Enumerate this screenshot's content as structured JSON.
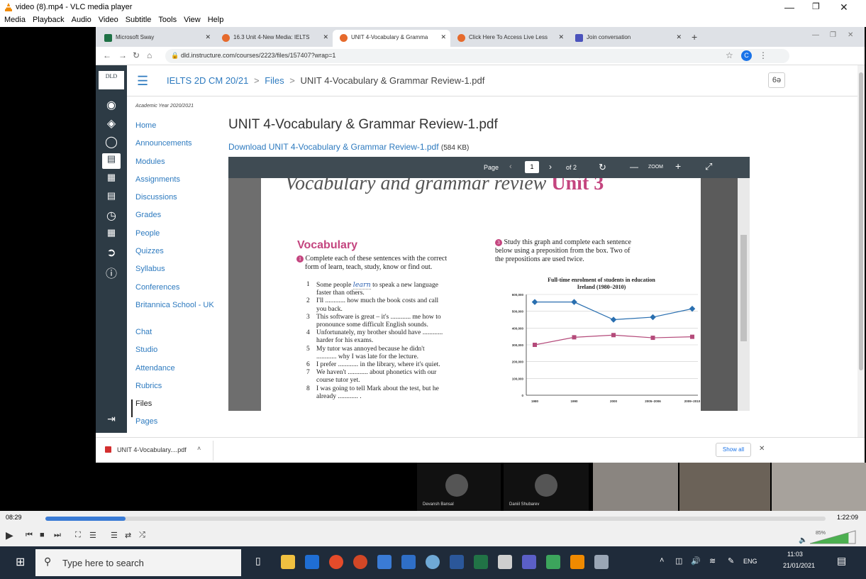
{
  "vlc": {
    "title": "video (8).mp4 - VLC media player",
    "menu": [
      "Media",
      "Playback",
      "Audio",
      "Video",
      "Subtitle",
      "Tools",
      "View",
      "Help"
    ],
    "time_elapsed": "08:29",
    "time_total": "1:22:09",
    "volume": "85%",
    "progress": 0.103
  },
  "browser": {
    "tabs": [
      {
        "label": "Microsoft Sway",
        "color": "#1e7145"
      },
      {
        "label": "16.3 Unit 4-New Media: IELTS",
        "color": "#e66a2c"
      },
      {
        "label": "UNIT 4-Vocabulary & Gramma",
        "color": "#e66a2c"
      },
      {
        "label": "Click Here To Access Live Less",
        "color": "#e66a2c"
      },
      {
        "label": "Join conversation",
        "color": "#4b53bc"
      }
    ],
    "url": "dld.instructure.com/courses/2223/files/157407?wrap=1",
    "profile_initial": "C"
  },
  "canvas": {
    "breadcrumb": {
      "course": "IELTS 2D CM 20/21",
      "sep1": ">",
      "files": "Files",
      "sep2": ">",
      "file": "UNIT 4-Vocabulary & Grammar Review-1.pdf"
    },
    "logo": "DLD",
    "year": "Academic Year 2020/2021",
    "nav": [
      "Home",
      "Announcements",
      "Modules",
      "Assignments",
      "Discussions",
      "Grades",
      "People",
      "Quizzes",
      "Syllabus",
      "Conferences",
      "Britannica School - UK",
      "Chat",
      "Studio",
      "Attendance",
      "Rubrics",
      "Files",
      "Pages"
    ],
    "title": "UNIT 4-Vocabulary & Grammar Review-1.pdf",
    "download_link": "Download UNIT 4-Vocabulary & Grammar Review-1.pdf",
    "download_size": "(584 KB)",
    "view_btn": "6ə"
  },
  "pdf": {
    "page_label": "Page",
    "page_current": "1",
    "page_of": "of 2",
    "zoom_label": "ZOOM",
    "banner": "Vocabulary and grammar review",
    "banner_unit": "Unit 3",
    "vocab_heading": "Vocabulary",
    "ex1_num": "1",
    "ex1_instr_a": "Complete each of these sentences with the correct",
    "ex1_instr_b": "form of learn, teach, study, know or find out.",
    "ex1_items": [
      {
        "n": "1",
        "a": "Some people ",
        "hand": "learn",
        "b": " to speak a new language",
        "c": "faster than others."
      },
      {
        "n": "2",
        "a": "I'll ............ how much the book costs and call",
        "b": "",
        "c": "you back."
      },
      {
        "n": "3",
        "a": "This software is great – it's ............ me how to",
        "b": "",
        "c": "pronounce some difficult English sounds."
      },
      {
        "n": "4",
        "a": "Unfortunately, my brother should have ............",
        "b": "",
        "c": "harder for his exams."
      },
      {
        "n": "5",
        "a": "My tutor was annoyed because he didn't",
        "b": "",
        "c": "............ why I was late for the lecture."
      },
      {
        "n": "6",
        "a": "I prefer ............ in the library, where it's quiet.",
        "b": "",
        "c": ""
      },
      {
        "n": "7",
        "a": "We haven't ............ about phonetics with our",
        "b": "",
        "c": "course tutor yet."
      },
      {
        "n": "8",
        "a": "I was going to tell Mark about the test, but he",
        "b": "",
        "c": "already ............ ."
      }
    ],
    "ex3_num": "3",
    "ex3_instr": [
      "Study this graph and complete each sentence",
      "below using a preposition from the box. Two of",
      "the prepositions are used twice."
    ]
  },
  "chart_data": {
    "type": "line",
    "title": "Full-time enrolment of students in education in Ireland (1980–2010)",
    "categories": [
      "1980",
      "1990",
      "2000",
      "2005–2006",
      "2009–2010"
    ],
    "series": [
      {
        "values": [
          555000,
          555000,
          450000,
          465000,
          515000
        ],
        "color": "#2a6fb0"
      },
      {
        "values": [
          300000,
          345000,
          358000,
          342000,
          348000
        ],
        "color": "#b44a7a"
      }
    ],
    "yticks": [
      "0",
      "100,000",
      "200,000",
      "300,000",
      "400,000",
      "500,000",
      "600,000"
    ],
    "ylim": [
      0,
      600000
    ],
    "grid": true
  },
  "downloads": {
    "file": "UNIT 4-Vocabulary....pdf",
    "show_all": "Show all"
  },
  "participants": [
    {
      "name": "Devansh Bansal"
    },
    {
      "name": "Daniil Shubarev"
    }
  ],
  "taskbar": {
    "search": "Type here to search",
    "lang": "ENG",
    "time": "11:03",
    "date": "21/01/2021"
  }
}
